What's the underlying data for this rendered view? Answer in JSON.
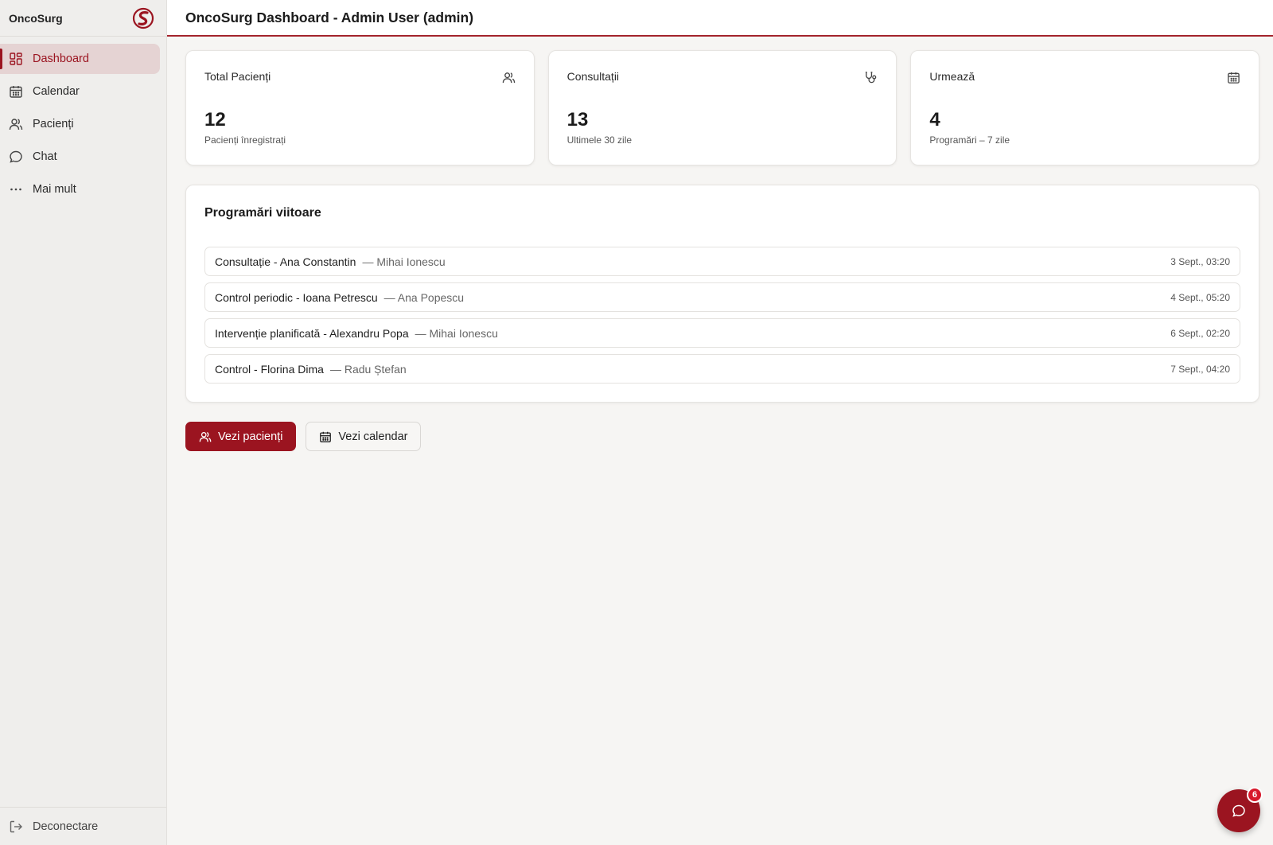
{
  "sidebar": {
    "brand": "OncoSurg",
    "items": [
      {
        "label": "Dashboard",
        "icon": "grid-icon",
        "active": true
      },
      {
        "label": "Calendar",
        "icon": "calendar-icon"
      },
      {
        "label": "Pacienți",
        "icon": "users-icon"
      },
      {
        "label": "Chat",
        "icon": "chat-icon"
      },
      {
        "label": "Mai mult",
        "icon": "more-icon"
      }
    ],
    "logout_label": "Deconectare"
  },
  "header": {
    "title": "OncoSurg Dashboard - Admin User (admin)"
  },
  "stats": [
    {
      "label": "Total Pacienți",
      "value": "12",
      "sub": "Pacienți înregistrați",
      "icon": "users-icon"
    },
    {
      "label": "Consultații",
      "value": "13",
      "sub": "Ultimele 30 zile",
      "icon": "stethoscope-icon"
    },
    {
      "label": "Urmează",
      "value": "4",
      "sub": "Programări – 7 zile",
      "icon": "calendar-icon"
    }
  ],
  "appointments": {
    "title": "Programări viitoare",
    "items": [
      {
        "name": "Consultație - Ana Constantin",
        "doctor": "— Mihai Ionescu",
        "date": "3 Sept., 03:20"
      },
      {
        "name": "Control periodic - Ioana Petrescu",
        "doctor": "— Ana Popescu",
        "date": "4 Sept., 05:20"
      },
      {
        "name": "Intervenție planificată - Alexandru Popa",
        "doctor": "— Mihai Ionescu",
        "date": "6 Sept., 02:20"
      },
      {
        "name": "Control - Florina Dima",
        "doctor": "— Radu Ștefan",
        "date": "7 Sept., 04:20"
      }
    ]
  },
  "actions": {
    "patients_label": "Vezi pacienți",
    "calendar_label": "Vezi calendar"
  },
  "chat_fab": {
    "badge": "6"
  },
  "colors": {
    "accent": "#9b1420",
    "badge": "#d7182a",
    "active_bg": "#e5d3d3"
  }
}
